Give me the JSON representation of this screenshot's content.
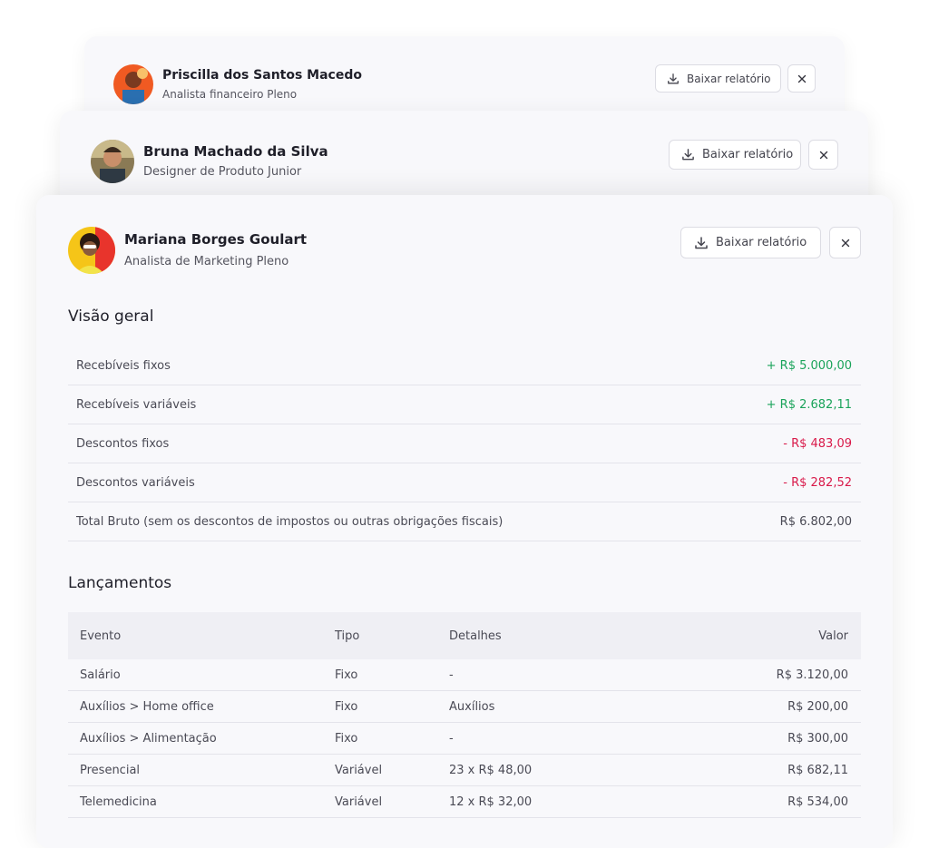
{
  "cards": [
    {
      "name": "Priscilla dos Santos Macedo",
      "role": "Analista financeiro Pleno",
      "download_label": "Baixar relatório"
    },
    {
      "name": "Bruna Machado da Silva",
      "role": "Designer de Produto Junior",
      "download_label": "Baixar relatório"
    },
    {
      "name": "Mariana Borges Goulart",
      "role": "Analista de Marketing Pleno",
      "download_label": "Baixar relatório"
    }
  ],
  "overview": {
    "title": "Visão geral",
    "rows": [
      {
        "label": "Recebíveis fixos",
        "value": "+ R$ 5.000,00",
        "tone": "pos"
      },
      {
        "label": "Recebíveis variáveis",
        "value": "+ R$ 2.682,11",
        "tone": "pos"
      },
      {
        "label": "Descontos fixos",
        "value": "- R$ 483,09",
        "tone": "neg"
      },
      {
        "label": "Descontos variáveis",
        "value": "- R$ 282,52",
        "tone": "neg"
      },
      {
        "label": "Total Bruto (sem os descontos de impostos ou outras obrigações fiscais)",
        "value": "R$ 6.802,00",
        "tone": "neu"
      }
    ]
  },
  "entries": {
    "title": "Lançamentos",
    "headers": {
      "evento": "Evento",
      "tipo": "Tipo",
      "detalhes": "Detalhes",
      "valor": "Valor"
    },
    "rows": [
      {
        "evento": "Salário",
        "tipo": "Fixo",
        "detalhes": "-",
        "valor": "R$ 3.120,00"
      },
      {
        "evento": "Auxílios > Home office",
        "tipo": "Fixo",
        "detalhes": "Auxílios",
        "valor": "R$ 200,00"
      },
      {
        "evento": "Auxílios > Alimentação",
        "tipo": "Fixo",
        "detalhes": "-",
        "valor": "R$ 300,00"
      },
      {
        "evento": "Presencial",
        "tipo": "Variável",
        "detalhes": "23 x R$ 48,00",
        "valor": "R$ 682,11"
      },
      {
        "evento": "Telemedicina",
        "tipo": "Variável",
        "detalhes": "12 x R$ 32,00",
        "valor": "R$ 534,00"
      }
    ]
  },
  "colors": {
    "positive": "#1aa35a",
    "negative": "#d91a4a"
  },
  "icons": {
    "download": "download-icon",
    "close": "close-icon"
  }
}
